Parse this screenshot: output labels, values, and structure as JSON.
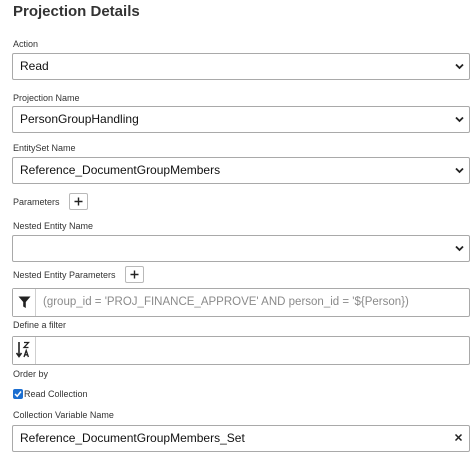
{
  "panel": {
    "title": "Projection Details"
  },
  "action": {
    "label": "Action",
    "value": "Read"
  },
  "projection": {
    "label": "Projection Name",
    "value": "PersonGroupHandling"
  },
  "entityset": {
    "label": "EntitySet Name",
    "value": "Reference_DocumentGroupMembers"
  },
  "parameters": {
    "label": "Parameters"
  },
  "nested_entity": {
    "label": "Nested Entity Name",
    "value": ""
  },
  "nested_params": {
    "label": "Nested Entity Parameters"
  },
  "filter": {
    "placeholder": "(group_id = 'PROJ_FINANCE_APPROVE' AND person_id = '${Person})",
    "label": "Define a filter",
    "icon": "filter-icon"
  },
  "order": {
    "label": "Order by",
    "value": "",
    "icon": "sort-alpha-icon"
  },
  "read_collection": {
    "label": "Read Collection",
    "checked": true
  },
  "collection_var": {
    "label": "Collection Variable Name",
    "value": "Reference_DocumentGroupMembers_Set"
  },
  "colors": {
    "checkbox": "#1b6ed0",
    "border": "#a9a9a9"
  }
}
